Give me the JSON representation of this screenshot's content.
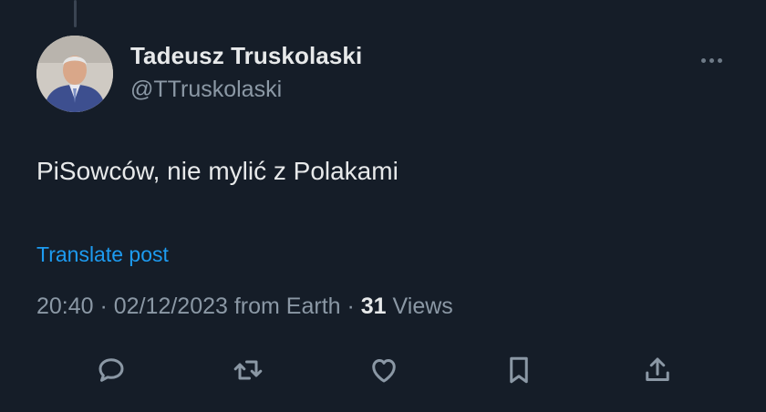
{
  "author": {
    "name": "Tadeusz Truskolaski",
    "handle": "@TTruskolaski"
  },
  "post": {
    "text": "PiSowców, nie mylić z Polakami",
    "translate_label": "Translate post"
  },
  "meta": {
    "time": "20:40",
    "separator1": " · ",
    "date": "02/12/2023",
    "source": " from Earth",
    "separator2": " · ",
    "views_count": "31",
    "views_label": " Views"
  },
  "actions": [
    {
      "icon": "reply-icon"
    },
    {
      "icon": "retweet-icon"
    },
    {
      "icon": "like-icon"
    },
    {
      "icon": "bookmark-icon"
    },
    {
      "icon": "share-icon"
    }
  ],
  "colors": {
    "background": "#151d28",
    "text_primary": "#e7e9ea",
    "text_secondary": "#8b98a5",
    "link": "#1d9bf0",
    "icon": "#8b98a5"
  }
}
